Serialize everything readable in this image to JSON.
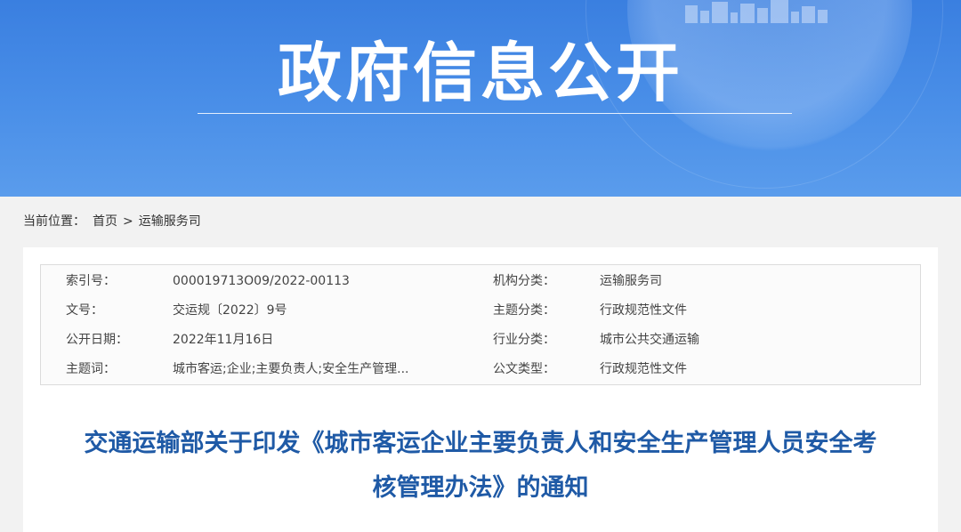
{
  "banner": {
    "title": "政府信息公开"
  },
  "breadcrumb": {
    "label": "当前位置：",
    "home": "首页",
    "separator": ">",
    "current": "运输服务司"
  },
  "meta": [
    {
      "k1": "索引号：",
      "v1": "000019713O09/2022-00113",
      "k2": "机构分类：",
      "v2": "运输服务司"
    },
    {
      "k1": "文号：",
      "v1": "交运规〔2022〕9号",
      "k2": "主题分类：",
      "v2": "行政规范性文件"
    },
    {
      "k1": "公开日期：",
      "v1": "2022年11月16日",
      "k2": "行业分类：",
      "v2": "城市公共交通运输"
    },
    {
      "k1": "主题词：",
      "v1": "城市客运;企业;主要负责人;安全生产管理...",
      "k2": "公文类型：",
      "v2": "行政规范性文件"
    }
  ],
  "document": {
    "title_line1": "交通运输部关于印发《城市客运企业主要负责人和安全生产管理人员安全考",
    "title_line2": "核管理办法》的通知"
  },
  "colors": {
    "banner": "#4a8fe8",
    "title": "#1f5aa6"
  }
}
